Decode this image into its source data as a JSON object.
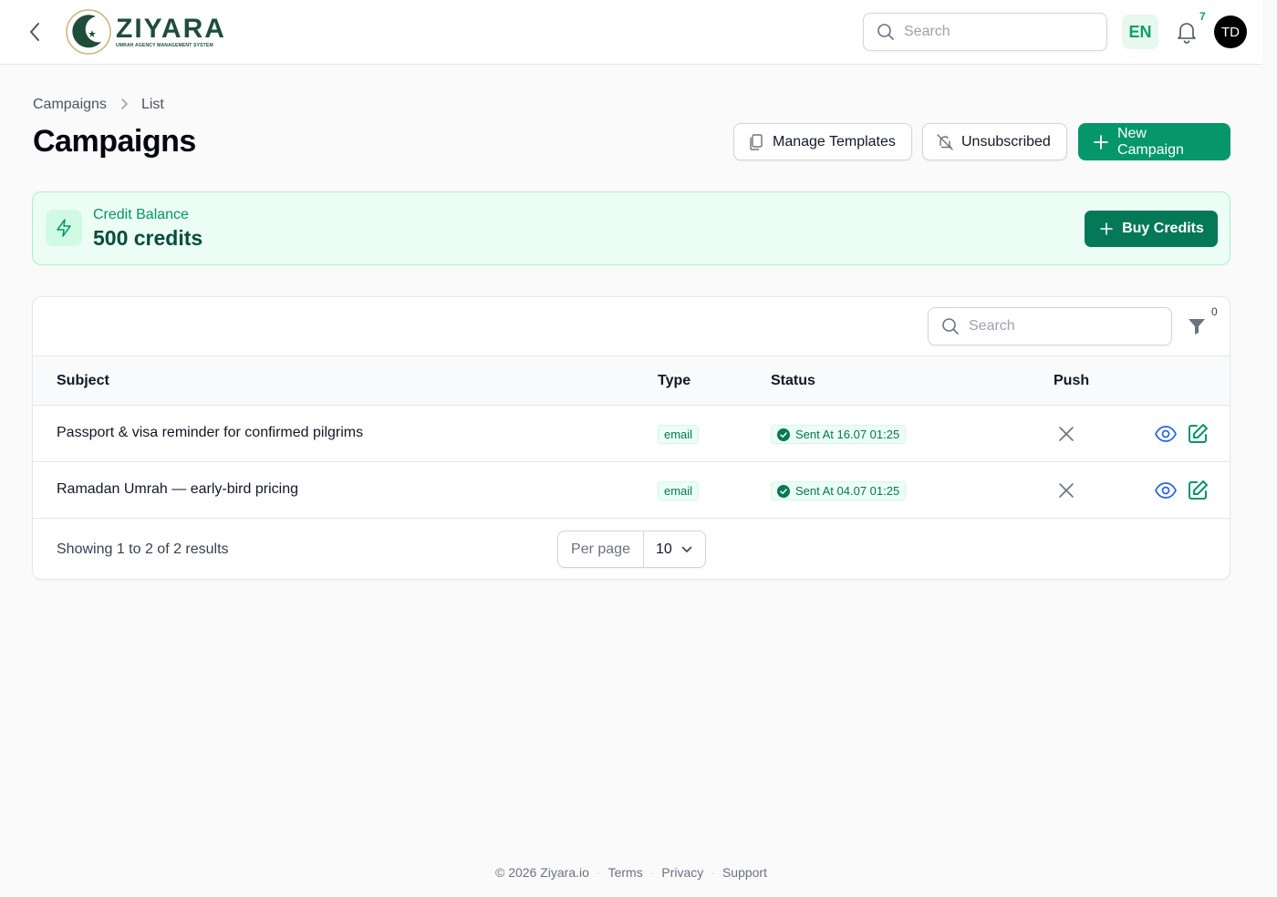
{
  "brand": {
    "name": "ZIYARA",
    "tagline": "UMRAH AGENCY MANAGEMENT SYSTEM",
    "color": "#1e4d3a"
  },
  "topbar": {
    "search_placeholder": "Search",
    "language": "EN",
    "notification_count": "7",
    "avatar_initials": "TD"
  },
  "breadcrumb": [
    "Campaigns",
    "List"
  ],
  "page": {
    "title": "Campaigns",
    "actions": {
      "manage_templates": "Manage Templates",
      "unsubscribed": "Unsubscribed",
      "new_campaign": "New Campaign"
    }
  },
  "credit": {
    "label": "Credit Balance",
    "value": "500 credits",
    "buy_label": "Buy Credits"
  },
  "table": {
    "search_placeholder": "Search",
    "filter_count": "0",
    "columns": {
      "subject": "Subject",
      "type": "Type",
      "status": "Status",
      "push": "Push"
    },
    "rows": [
      {
        "subject": "Passport & visa reminder for confirmed pilgrims",
        "type": "email",
        "status": "Sent At 16.07 01:25",
        "push": false
      },
      {
        "subject": "Ramadan Umrah — early-bird pricing",
        "type": "email",
        "status": "Sent At 04.07 01:25",
        "push": false
      }
    ],
    "showing": "Showing 1 to 2 of 2 results",
    "per_page_label": "Per page",
    "per_page_value": "10"
  },
  "footer": {
    "copyright": "© 2026 Ziyara.io",
    "links": [
      "Terms",
      "Privacy",
      "Support"
    ]
  },
  "colors": {
    "accent": "#059669",
    "accent_dark": "#047857",
    "credit_bg": "#ecfdf5",
    "action_blue": "#2563eb"
  }
}
